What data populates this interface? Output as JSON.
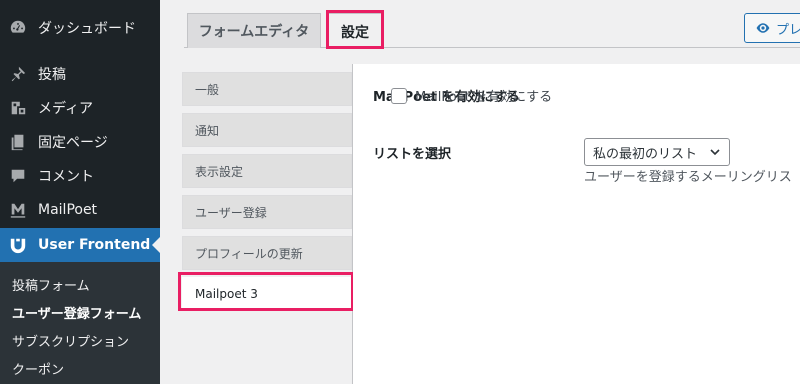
{
  "sidebar": {
    "items": [
      {
        "label": "ダッシュボード",
        "icon": "dashboard-icon"
      },
      {
        "label": "投稿",
        "icon": "pin-icon"
      },
      {
        "label": "メディア",
        "icon": "media-icon"
      },
      {
        "label": "固定ページ",
        "icon": "page-icon"
      },
      {
        "label": "コメント",
        "icon": "comment-icon"
      },
      {
        "label": "MailPoet",
        "icon": "mailpoet-icon"
      },
      {
        "label": "User Frontend",
        "icon": "user-frontend-icon"
      }
    ],
    "submenu": [
      "投稿フォーム",
      "ユーザー登録フォーム",
      "サブスクリプション",
      "クーポン"
    ]
  },
  "tabs": {
    "editor": "フォームエディタ",
    "settings": "設定"
  },
  "preview_button": "プレ",
  "settings_tabs": [
    "一般",
    "通知",
    "表示設定",
    "ユーザー登録",
    "プロフィールの更新",
    "Mailpoet 3"
  ],
  "mailpoet": {
    "enable_label": "MailPoet を有効にする",
    "enable_checkbox_label": "MailPoet を有効にする",
    "enable_checked": false,
    "list_label": "リストを選択",
    "list_value": "私の最初のリスト",
    "list_description": "ユーザーを登録するメーリングリス"
  },
  "colors": {
    "sidebar_bg": "#1d2327",
    "accent": "#2271b1",
    "highlight": "#e91e63"
  }
}
